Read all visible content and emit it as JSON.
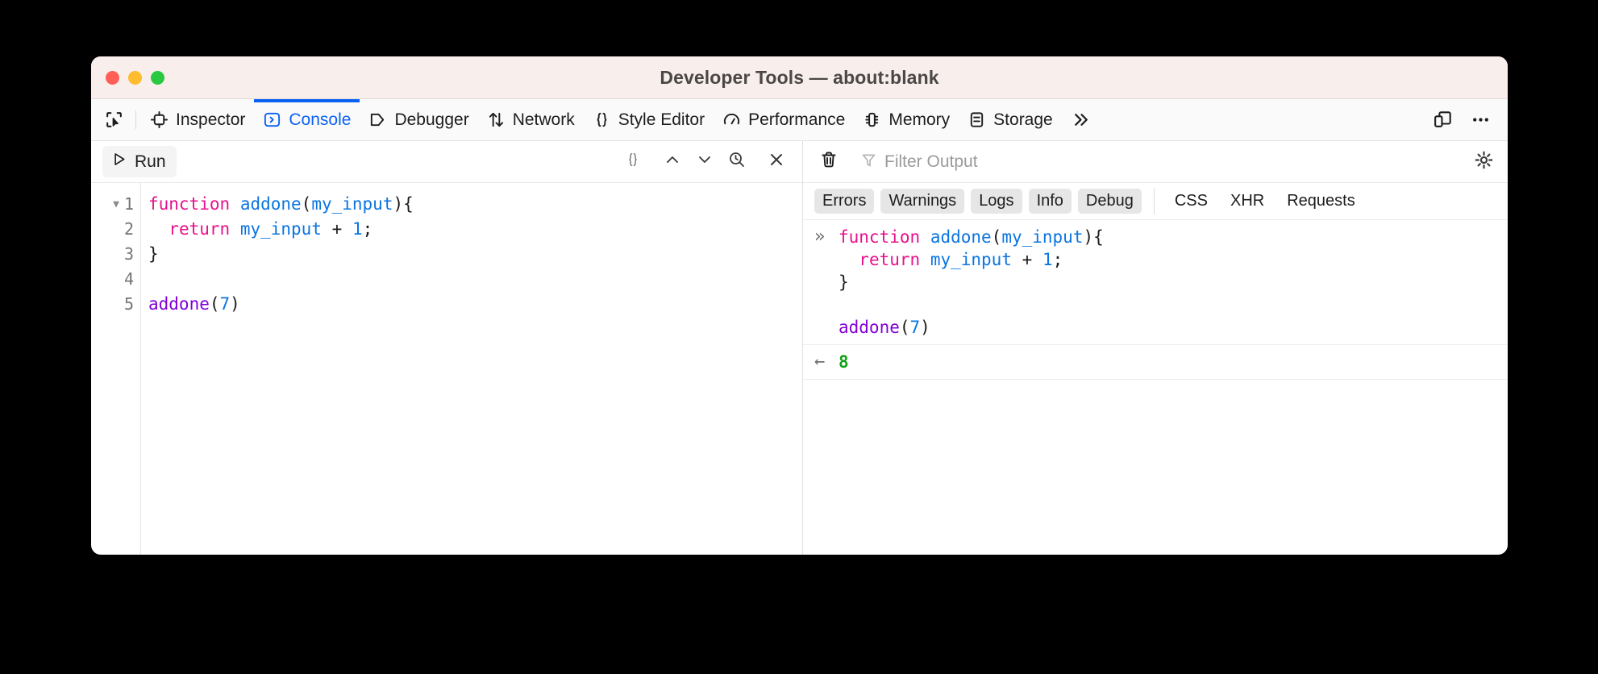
{
  "window": {
    "title": "Developer Tools — about:blank",
    "traffic_lights": [
      "close-button",
      "minimize-button",
      "zoom-button"
    ],
    "colors": {
      "titlebar_bg": "#f8efec",
      "accent": "#0a62f5",
      "close": "#ff5f57",
      "minimize": "#febc2e",
      "zoom": "#28c840",
      "result_green": "#14a014"
    }
  },
  "tabbar": {
    "picker_icon": "element-picker-icon",
    "tabs": [
      {
        "label": "Inspector",
        "icon": "inspector-icon",
        "active": false
      },
      {
        "label": "Console",
        "icon": "console-icon",
        "active": true
      },
      {
        "label": "Debugger",
        "icon": "debugger-icon",
        "active": false
      },
      {
        "label": "Network",
        "icon": "network-icon",
        "active": false
      },
      {
        "label": "Style Editor",
        "icon": "style-editor-icon",
        "active": false
      },
      {
        "label": "Performance",
        "icon": "performance-icon",
        "active": false
      },
      {
        "label": "Memory",
        "icon": "memory-icon",
        "active": false
      },
      {
        "label": "Storage",
        "icon": "storage-icon",
        "active": false
      }
    ],
    "overflow_icon": "chevron-double-right-icon",
    "responsive_icon": "responsive-design-mode-icon",
    "meatball_icon": "more-options-icon"
  },
  "editor": {
    "run_label": "Run",
    "run_icon": "play-icon",
    "tools": [
      {
        "icon": "pretty-print-icon",
        "glyph": "{ }"
      },
      {
        "icon": "chevron-up-icon",
        "glyph": "^"
      },
      {
        "icon": "chevron-down-icon",
        "glyph": "v"
      },
      {
        "icon": "history-search-icon",
        "glyph": "search"
      },
      {
        "icon": "close-icon",
        "glyph": "x"
      }
    ],
    "line_numbers": [
      "1",
      "2",
      "3",
      "4",
      "5"
    ],
    "fold_line": 1,
    "fold_icon": "fold-triangle-icon",
    "lines": [
      [
        {
          "t": "function",
          "c": "kw"
        },
        {
          "t": " ",
          "c": "p"
        },
        {
          "t": "addone",
          "c": "fn"
        },
        {
          "t": "(",
          "c": "p"
        },
        {
          "t": "my_input",
          "c": "var"
        },
        {
          "t": ")",
          "c": "p"
        },
        {
          "t": "{",
          "c": "p"
        }
      ],
      [
        {
          "t": "  ",
          "c": "p"
        },
        {
          "t": "return",
          "c": "kw"
        },
        {
          "t": " ",
          "c": "p"
        },
        {
          "t": "my_input",
          "c": "var"
        },
        {
          "t": " ",
          "c": "p"
        },
        {
          "t": "+",
          "c": "op"
        },
        {
          "t": " ",
          "c": "p"
        },
        {
          "t": "1",
          "c": "num"
        },
        {
          "t": ";",
          "c": "p"
        }
      ],
      [
        {
          "t": "}",
          "c": "p"
        }
      ],
      [
        {
          "t": "",
          "c": "p"
        }
      ],
      [
        {
          "t": "addone",
          "c": "call"
        },
        {
          "t": "(",
          "c": "p"
        },
        {
          "t": "7",
          "c": "num"
        },
        {
          "t": ")",
          "c": "p"
        }
      ]
    ]
  },
  "console": {
    "clear_icon": "trash-icon",
    "filter_icon": "funnel-icon",
    "filter_placeholder": "Filter Output",
    "settings_icon": "gear-icon",
    "filters": [
      {
        "label": "Errors",
        "chip": true
      },
      {
        "label": "Warnings",
        "chip": true
      },
      {
        "label": "Logs",
        "chip": true
      },
      {
        "label": "Info",
        "chip": true
      },
      {
        "label": "Debug",
        "chip": true
      },
      {
        "label": "CSS",
        "chip": false
      },
      {
        "label": "XHR",
        "chip": false
      },
      {
        "label": "Requests",
        "chip": false
      }
    ],
    "entries": [
      {
        "marker": "»",
        "type": "input",
        "lines": [
          [
            {
              "t": "function",
              "c": "kw"
            },
            {
              "t": " ",
              "c": "p"
            },
            {
              "t": "addone",
              "c": "fn"
            },
            {
              "t": "(",
              "c": "p"
            },
            {
              "t": "my_input",
              "c": "var"
            },
            {
              "t": ")",
              "c": "p"
            },
            {
              "t": "{",
              "c": "p"
            }
          ],
          [
            {
              "t": "  ",
              "c": "p"
            },
            {
              "t": "return",
              "c": "kw"
            },
            {
              "t": " ",
              "c": "p"
            },
            {
              "t": "my_input",
              "c": "var"
            },
            {
              "t": " ",
              "c": "p"
            },
            {
              "t": "+",
              "c": "op"
            },
            {
              "t": " ",
              "c": "p"
            },
            {
              "t": "1",
              "c": "num"
            },
            {
              "t": ";",
              "c": "p"
            }
          ],
          [
            {
              "t": "}",
              "c": "p"
            }
          ],
          [
            {
              "t": "",
              "c": "p"
            }
          ],
          [
            {
              "t": "addone",
              "c": "call"
            },
            {
              "t": "(",
              "c": "p"
            },
            {
              "t": "7",
              "c": "num"
            },
            {
              "t": ")",
              "c": "p"
            }
          ]
        ]
      },
      {
        "marker": "←",
        "type": "result",
        "value": "8"
      }
    ]
  }
}
